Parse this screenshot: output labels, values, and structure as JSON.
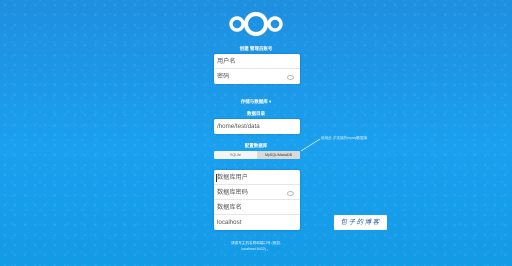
{
  "logo": {
    "icon": "nextcloud-logo-icon"
  },
  "admin": {
    "title": "创建 管理员账号",
    "username_placeholder": "用户名",
    "password_placeholder": "密码"
  },
  "storage_title": "存储与数据库 ▾",
  "data_dir": {
    "label": "数据目录",
    "value": "/home/test/data"
  },
  "database": {
    "label": "配置数据库",
    "options": [
      "SQLite",
      "MySQL/MariaDB"
    ],
    "selected": "MySQL/MariaDB",
    "note": "使用此 才连接的mysql数据库",
    "user_placeholder": "数据库用户",
    "password_placeholder": "数据库密码",
    "name_placeholder": "数据库名",
    "host_value": "localhost"
  },
  "footer": {
    "line1": "请填写主机名称和端口号 (例如,",
    "line2": "localhost:5432) 。"
  },
  "watermark": "包子的博客",
  "colors": {
    "background": "#1a9be6",
    "accent": "#0082c9"
  }
}
